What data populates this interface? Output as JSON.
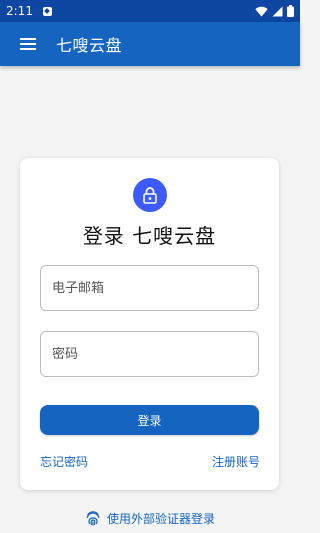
{
  "status_bar": {
    "time": "2:11"
  },
  "app_bar": {
    "title": "七嗖云盘"
  },
  "login_card": {
    "title": "登录 七嗖云盘",
    "email_placeholder": "电子邮箱",
    "password_placeholder": "密码",
    "login_button": "登录",
    "forgot_password": "忘记密码",
    "register": "注册账号"
  },
  "external_auth": {
    "label": "使用外部验证器登录"
  },
  "icons": {
    "menu": "hamburger-menu-icon",
    "lock": "lock-icon",
    "fingerprint": "fingerprint-icon",
    "wifi": "wifi-icon",
    "signal": "signal-icon",
    "battery": "battery-icon",
    "notification": "notification-icon"
  },
  "colors": {
    "status_bar": "#0d47a1",
    "app_bar": "#1565c0",
    "lock_avatar": "#3d5afe",
    "accent": "#1565c0",
    "background": "#f4f4f4"
  }
}
